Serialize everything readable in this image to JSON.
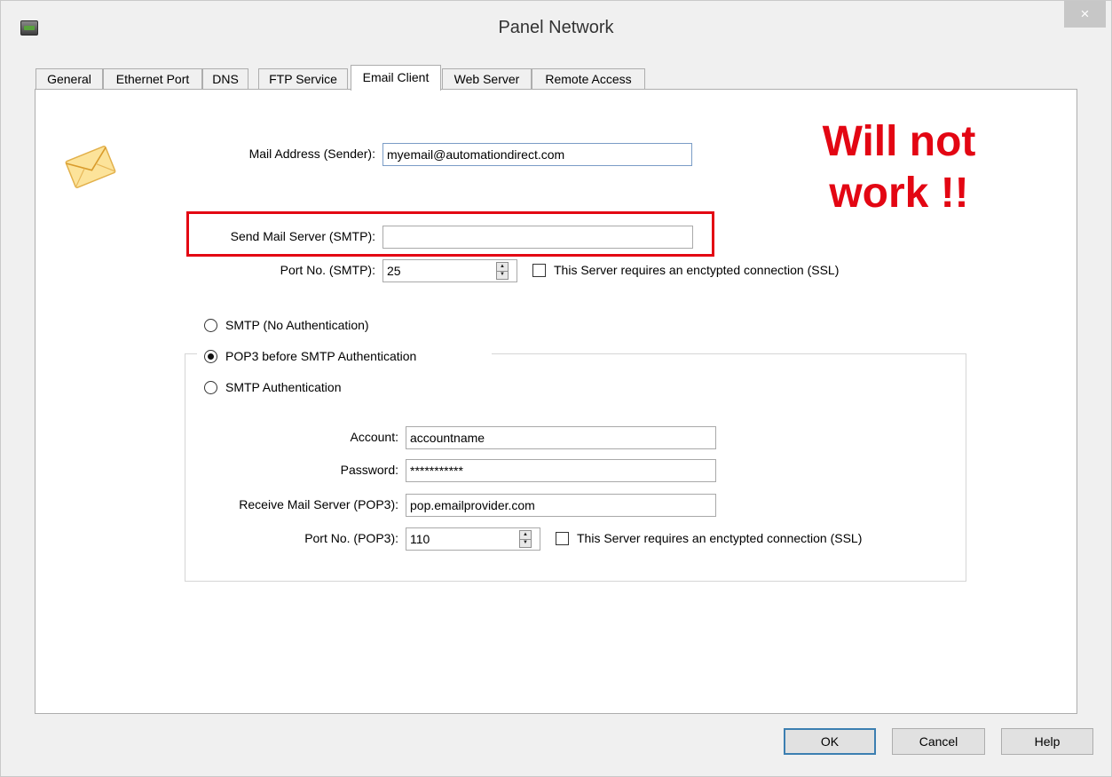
{
  "window": {
    "title": "Panel Network",
    "close_label": "×"
  },
  "tabs": [
    {
      "label": "General"
    },
    {
      "label": "Ethernet Port"
    },
    {
      "label": "DNS"
    },
    {
      "label": "FTP Service"
    },
    {
      "label": "Email Client"
    },
    {
      "label": "Web Server"
    },
    {
      "label": "Remote Access"
    }
  ],
  "active_tab": "Email Client",
  "form": {
    "mail_address_label": "Mail Address (Sender):",
    "mail_address_value": "myemail@automationdirect.com",
    "smtp_server_label": "Send Mail Server (SMTP):",
    "smtp_server_value": "",
    "smtp_port_label": "Port No. (SMTP):",
    "smtp_port_value": "25",
    "smtp_ssl_label": "This Server requires an enctypted connection (SSL)",
    "smtp_ssl_checked": false,
    "auth_options": [
      {
        "label": "SMTP (No Authentication)",
        "checked": false
      },
      {
        "label": "POP3 before SMTP Authentication",
        "checked": true
      },
      {
        "label": "SMTP Authentication",
        "checked": false
      }
    ],
    "account_label": "Account:",
    "account_value": "accountname",
    "password_label": "Password:",
    "password_value": "***********",
    "pop3_server_label": "Receive Mail Server (POP3):",
    "pop3_server_value": "pop.emailprovider.com",
    "pop3_port_label": "Port No. (POP3):",
    "pop3_port_value": "110",
    "pop3_ssl_label": "This Server requires an enctypted connection (SSL)",
    "pop3_ssl_checked": false
  },
  "annotation": {
    "line1": "Will not",
    "line2": "work !!",
    "color": "#e30613"
  },
  "icons": {
    "envelope": "envelope-icon",
    "app": "app-icon"
  },
  "buttons": {
    "ok": "OK",
    "cancel": "Cancel",
    "help": "Help"
  }
}
